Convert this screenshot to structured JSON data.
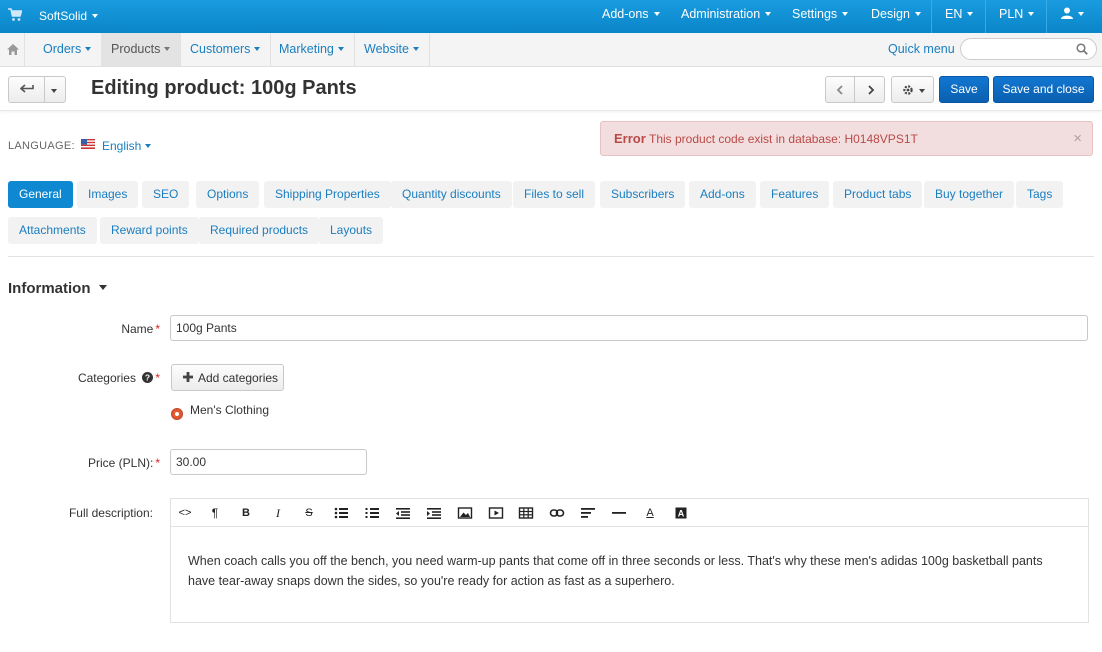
{
  "topbar": {
    "brand": "SoftSolid",
    "items": [
      "Add-ons",
      "Administration",
      "Settings",
      "Design",
      "EN",
      "PLN"
    ]
  },
  "nav": {
    "items": [
      "Orders",
      "Products",
      "Customers",
      "Marketing",
      "Website"
    ],
    "active": "Products",
    "quick_menu": "Quick menu",
    "search_placeholder": ""
  },
  "header": {
    "title": "Editing product: 100g Pants",
    "save": "Save",
    "save_close": "Save and close"
  },
  "language": {
    "label": "LANGUAGE:",
    "value": "English"
  },
  "error": {
    "title": "Error",
    "message": "This product code exist in database: H0148VPS1T",
    "close": "×"
  },
  "tabs": {
    "row1": [
      "General",
      "Images",
      "SEO",
      "Options",
      "Shipping Properties",
      "Quantity discounts",
      "Files to sell",
      "Subscribers",
      "Add-ons",
      "Features",
      "Product tabs",
      "Buy together",
      "Tags"
    ],
    "row2": [
      "Attachments",
      "Reward points",
      "Required products",
      "Layouts"
    ],
    "active": "General"
  },
  "form": {
    "section": "Information",
    "name_label": "Name",
    "name_value": "100g Pants",
    "categories_label": "Categories",
    "add_categories": "Add categories",
    "category": "Men's Clothing",
    "price_label": "Price (PLN):",
    "price_value": "30.00",
    "desc_label": "Full description:",
    "description": "When coach calls you off the bench, you need warm-up pants that come off in three seconds or less. That's why these men's adidas 100g basketball pants have tear-away snaps down the sides, so you're ready for action as fast as a superhero."
  },
  "colors": {
    "topbar": "#0a86c9",
    "accent": "#0e88d1",
    "primary_button": "#0a5fb0",
    "error_bg": "#f2dede",
    "error_text": "#b94a48"
  }
}
